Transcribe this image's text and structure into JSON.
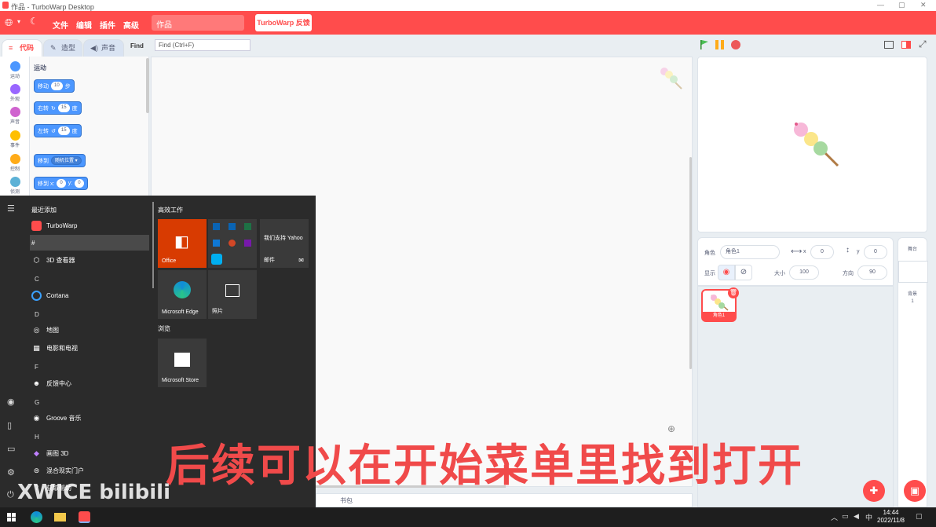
{
  "window": {
    "title": "作品 - TurboWarp Desktop",
    "controls": {
      "minimize": "—",
      "maximize": "▢",
      "close": "✕"
    }
  },
  "menubar": {
    "items": [
      "文件",
      "编辑",
      "插件",
      "高级"
    ],
    "project_title": "作品",
    "feedback_label": "TurboWarp 反馈"
  },
  "editor_tabs": [
    {
      "label": "代码",
      "icon": "code-icon"
    },
    {
      "label": "造型",
      "icon": "brush-icon"
    },
    {
      "label": "声音",
      "icon": "speaker-icon"
    }
  ],
  "find": {
    "button": "Find",
    "placeholder": "Find (Ctrl+F)"
  },
  "categories": [
    {
      "label": "运动",
      "color": "#4c97ff"
    },
    {
      "label": "外观",
      "color": "#9966ff"
    },
    {
      "label": "声音",
      "color": "#cf63cf"
    },
    {
      "label": "事件",
      "color": "#ffbf00"
    },
    {
      "label": "控制",
      "color": "#ffab19"
    },
    {
      "label": "侦测",
      "color": "#5cb1d6"
    }
  ],
  "palette": {
    "section_title": "运动",
    "blocks": {
      "move": {
        "label": "移动",
        "value": "10",
        "suffix": "步"
      },
      "turn_right": {
        "label": "右转",
        "value": "15",
        "suffix": "度"
      },
      "turn_left": {
        "label": "左转",
        "value": "15",
        "suffix": "度"
      },
      "goto": {
        "label": "移到",
        "dropdown": "随机位置 ▾"
      },
      "goto_xy": {
        "label": "移到 x:",
        "x": "0",
        "ylabel": "y:",
        "y": "0"
      }
    }
  },
  "code_area": {
    "backpack_label": "书包"
  },
  "sprite_info": {
    "sprite_label": "角色",
    "sprite_name": "角色1",
    "x_label": "x",
    "x_value": "0",
    "y_label": "y",
    "y_value": "0",
    "show_label": "显示",
    "size_label": "大小",
    "size_value": "100",
    "direction_label": "方向",
    "direction_value": "90"
  },
  "sprite_list": [
    {
      "name": "角色1"
    }
  ],
  "stage_panel": {
    "title": "舞台",
    "backdrop_label": "背景",
    "backdrop_count": "1"
  },
  "start_menu": {
    "recent_header": "最近添加",
    "apps": [
      {
        "type": "app",
        "label": "TurboWarp",
        "icon": "turbowarp-icon"
      },
      {
        "type": "letter",
        "label": "#"
      },
      {
        "type": "app",
        "label": "3D 查看器",
        "icon": "cube-icon"
      },
      {
        "type": "letter",
        "label": "C"
      },
      {
        "type": "app",
        "label": "Cortana",
        "icon": "cortana-icon"
      },
      {
        "type": "letter",
        "label": "D"
      },
      {
        "type": "app",
        "label": "地图",
        "icon": "map-pin-icon"
      },
      {
        "type": "app",
        "label": "电影和电视",
        "icon": "film-icon"
      },
      {
        "type": "letter",
        "label": "F"
      },
      {
        "type": "app",
        "label": "反馈中心",
        "icon": "feedback-hub-icon"
      },
      {
        "type": "letter",
        "label": "G"
      },
      {
        "type": "app",
        "label": "Groove 音乐",
        "icon": "groove-icon"
      },
      {
        "type": "letter",
        "label": "H"
      },
      {
        "type": "app",
        "label": "画图 3D",
        "icon": "paint3d-icon"
      },
      {
        "type": "app",
        "label": "混合现实门户",
        "icon": "mixed-reality-icon"
      },
      {
        "type": "app",
        "label": "获取帮助",
        "icon": "help-icon"
      }
    ],
    "tiles_header": "高效工作",
    "tiles": {
      "office": "Office",
      "yahoo": "我们支持 Yahoo",
      "mail": "邮件",
      "edge": "Microsoft Edge",
      "photos": "照片"
    },
    "browse_header": "浏览",
    "store": "Microsoft Store"
  },
  "subtitle": "后续可以在开始菜单里找到打开",
  "watermark": "XWICE bilibili",
  "taskbar": {
    "ime": "中",
    "time": "14:44",
    "date": "2022/11/8"
  }
}
